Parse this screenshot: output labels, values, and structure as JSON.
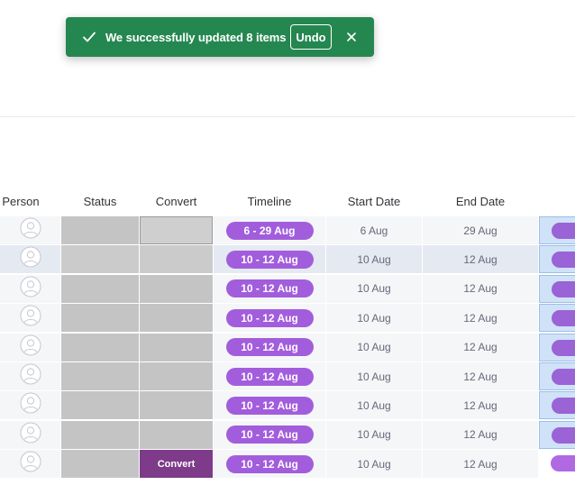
{
  "toast": {
    "message": "We successfully updated 8 items",
    "undo_label": "Undo",
    "color": "#258750"
  },
  "table": {
    "columns": [
      "Person",
      "Status",
      "Convert",
      "Timeline",
      "Start Date",
      "End Date"
    ],
    "rows": [
      {
        "timeline": "6 - 29 Aug",
        "start": "6 Aug",
        "end": "29 Aug",
        "convert": ""
      },
      {
        "timeline": "10 - 12 Aug",
        "start": "10 Aug",
        "end": "12 Aug",
        "convert": ""
      },
      {
        "timeline": "10 - 12 Aug",
        "start": "10 Aug",
        "end": "12 Aug",
        "convert": ""
      },
      {
        "timeline": "10 - 12 Aug",
        "start": "10 Aug",
        "end": "12 Aug",
        "convert": ""
      },
      {
        "timeline": "10 - 12 Aug",
        "start": "10 Aug",
        "end": "12 Aug",
        "convert": ""
      },
      {
        "timeline": "10 - 12 Aug",
        "start": "10 Aug",
        "end": "12 Aug",
        "convert": ""
      },
      {
        "timeline": "10 - 12 Aug",
        "start": "10 Aug",
        "end": "12 Aug",
        "convert": ""
      },
      {
        "timeline": "10 - 12 Aug",
        "start": "10 Aug",
        "end": "12 Aug",
        "convert": ""
      },
      {
        "timeline": "10 - 12 Aug",
        "start": "10 Aug",
        "end": "12 Aug",
        "convert": "Convert"
      }
    ]
  },
  "colors": {
    "timeline_pill": "#a25ddc",
    "convert_button": "#7e3b8a",
    "status_empty": "#c4c4c4"
  }
}
